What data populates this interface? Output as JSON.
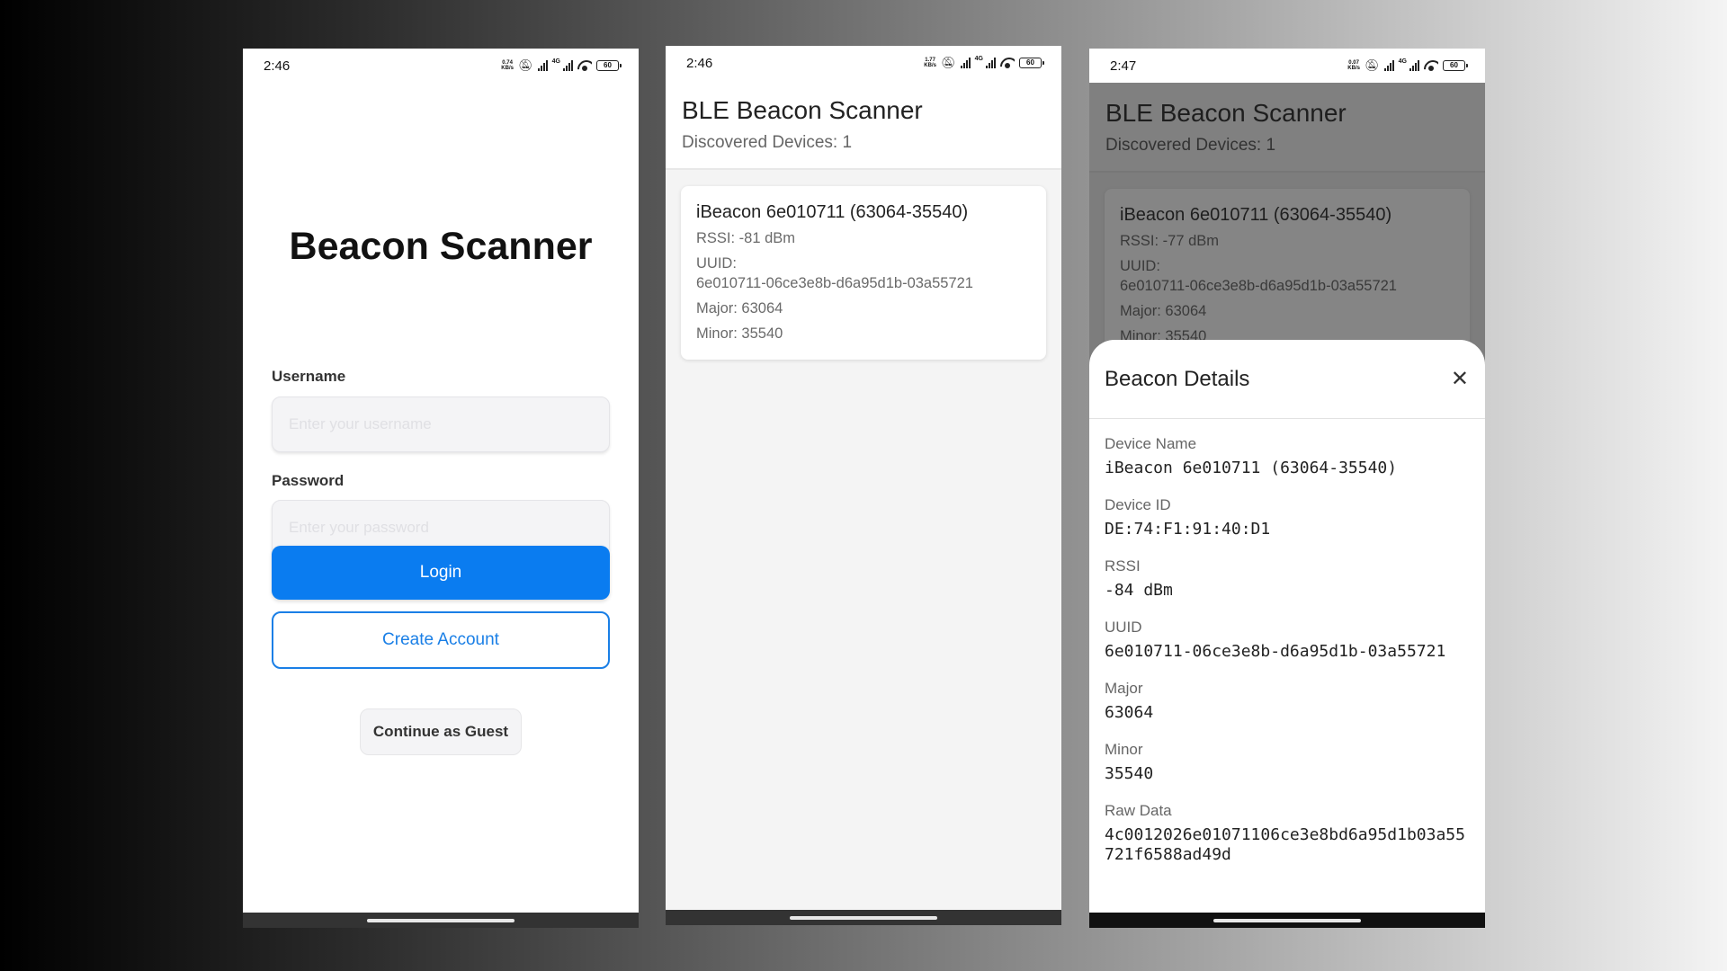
{
  "phone1": {
    "status": {
      "time": "2:46",
      "rate": "0.74\nKB/s",
      "battery": "60"
    },
    "title": "Beacon Scanner",
    "username_label": "Username",
    "username_placeholder": "Enter your username",
    "password_label": "Password",
    "password_placeholder": "Enter your password",
    "login_label": "Login",
    "create_account_label": "Create Account",
    "guest_label": "Continue as Guest"
  },
  "phone2": {
    "status": {
      "time": "2:46",
      "rate": "1.77\nKB/s",
      "battery": "60"
    },
    "title": "BLE Beacon Scanner",
    "subtitle": "Discovered Devices: 1",
    "device": {
      "name": "iBeacon 6e010711 (63064-35540)",
      "rssi": "RSSI: -81 dBm",
      "uuid_label": "UUID:",
      "uuid": "6e010711-06ce3e8b-d6a95d1b-03a55721",
      "major": "Major: 63064",
      "minor": "Minor: 35540"
    }
  },
  "phone3": {
    "status": {
      "time": "2:47",
      "rate": "0.07\nKB/s",
      "battery": "60"
    },
    "title": "BLE Beacon Scanner",
    "subtitle": "Discovered Devices: 1",
    "device": {
      "name": "iBeacon 6e010711 (63064-35540)",
      "rssi": "RSSI: -77 dBm",
      "uuid_label": "UUID:",
      "uuid": "6e010711-06ce3e8b-d6a95d1b-03a55721",
      "major": "Major: 63064",
      "minor": "Minor: 35540"
    },
    "sheet": {
      "title": "Beacon Details",
      "close_glyph": "✕",
      "fields": [
        {
          "label": "Device Name",
          "value": "iBeacon 6e010711 (63064-35540)"
        },
        {
          "label": "Device ID",
          "value": "DE:74:F1:91:40:D1"
        },
        {
          "label": "RSSI",
          "value": "-84 dBm"
        },
        {
          "label": "UUID",
          "value": "6e010711-06ce3e8b-d6a95d1b-03a55721"
        },
        {
          "label": "Major",
          "value": "63064"
        },
        {
          "label": "Minor",
          "value": "35540"
        },
        {
          "label": "Raw Data",
          "value": "4c0012026e01071106ce3e8bd6a95d1b03a55721f6588ad49d"
        }
      ]
    }
  },
  "colors": {
    "primary": "#0a7cf0",
    "outline": "#1a7fe6",
    "dim_overlay": "#7d7d7d"
  },
  "icons": [
    "mute-icon",
    "signal-icon",
    "wifi-icon",
    "battery-icon"
  ]
}
